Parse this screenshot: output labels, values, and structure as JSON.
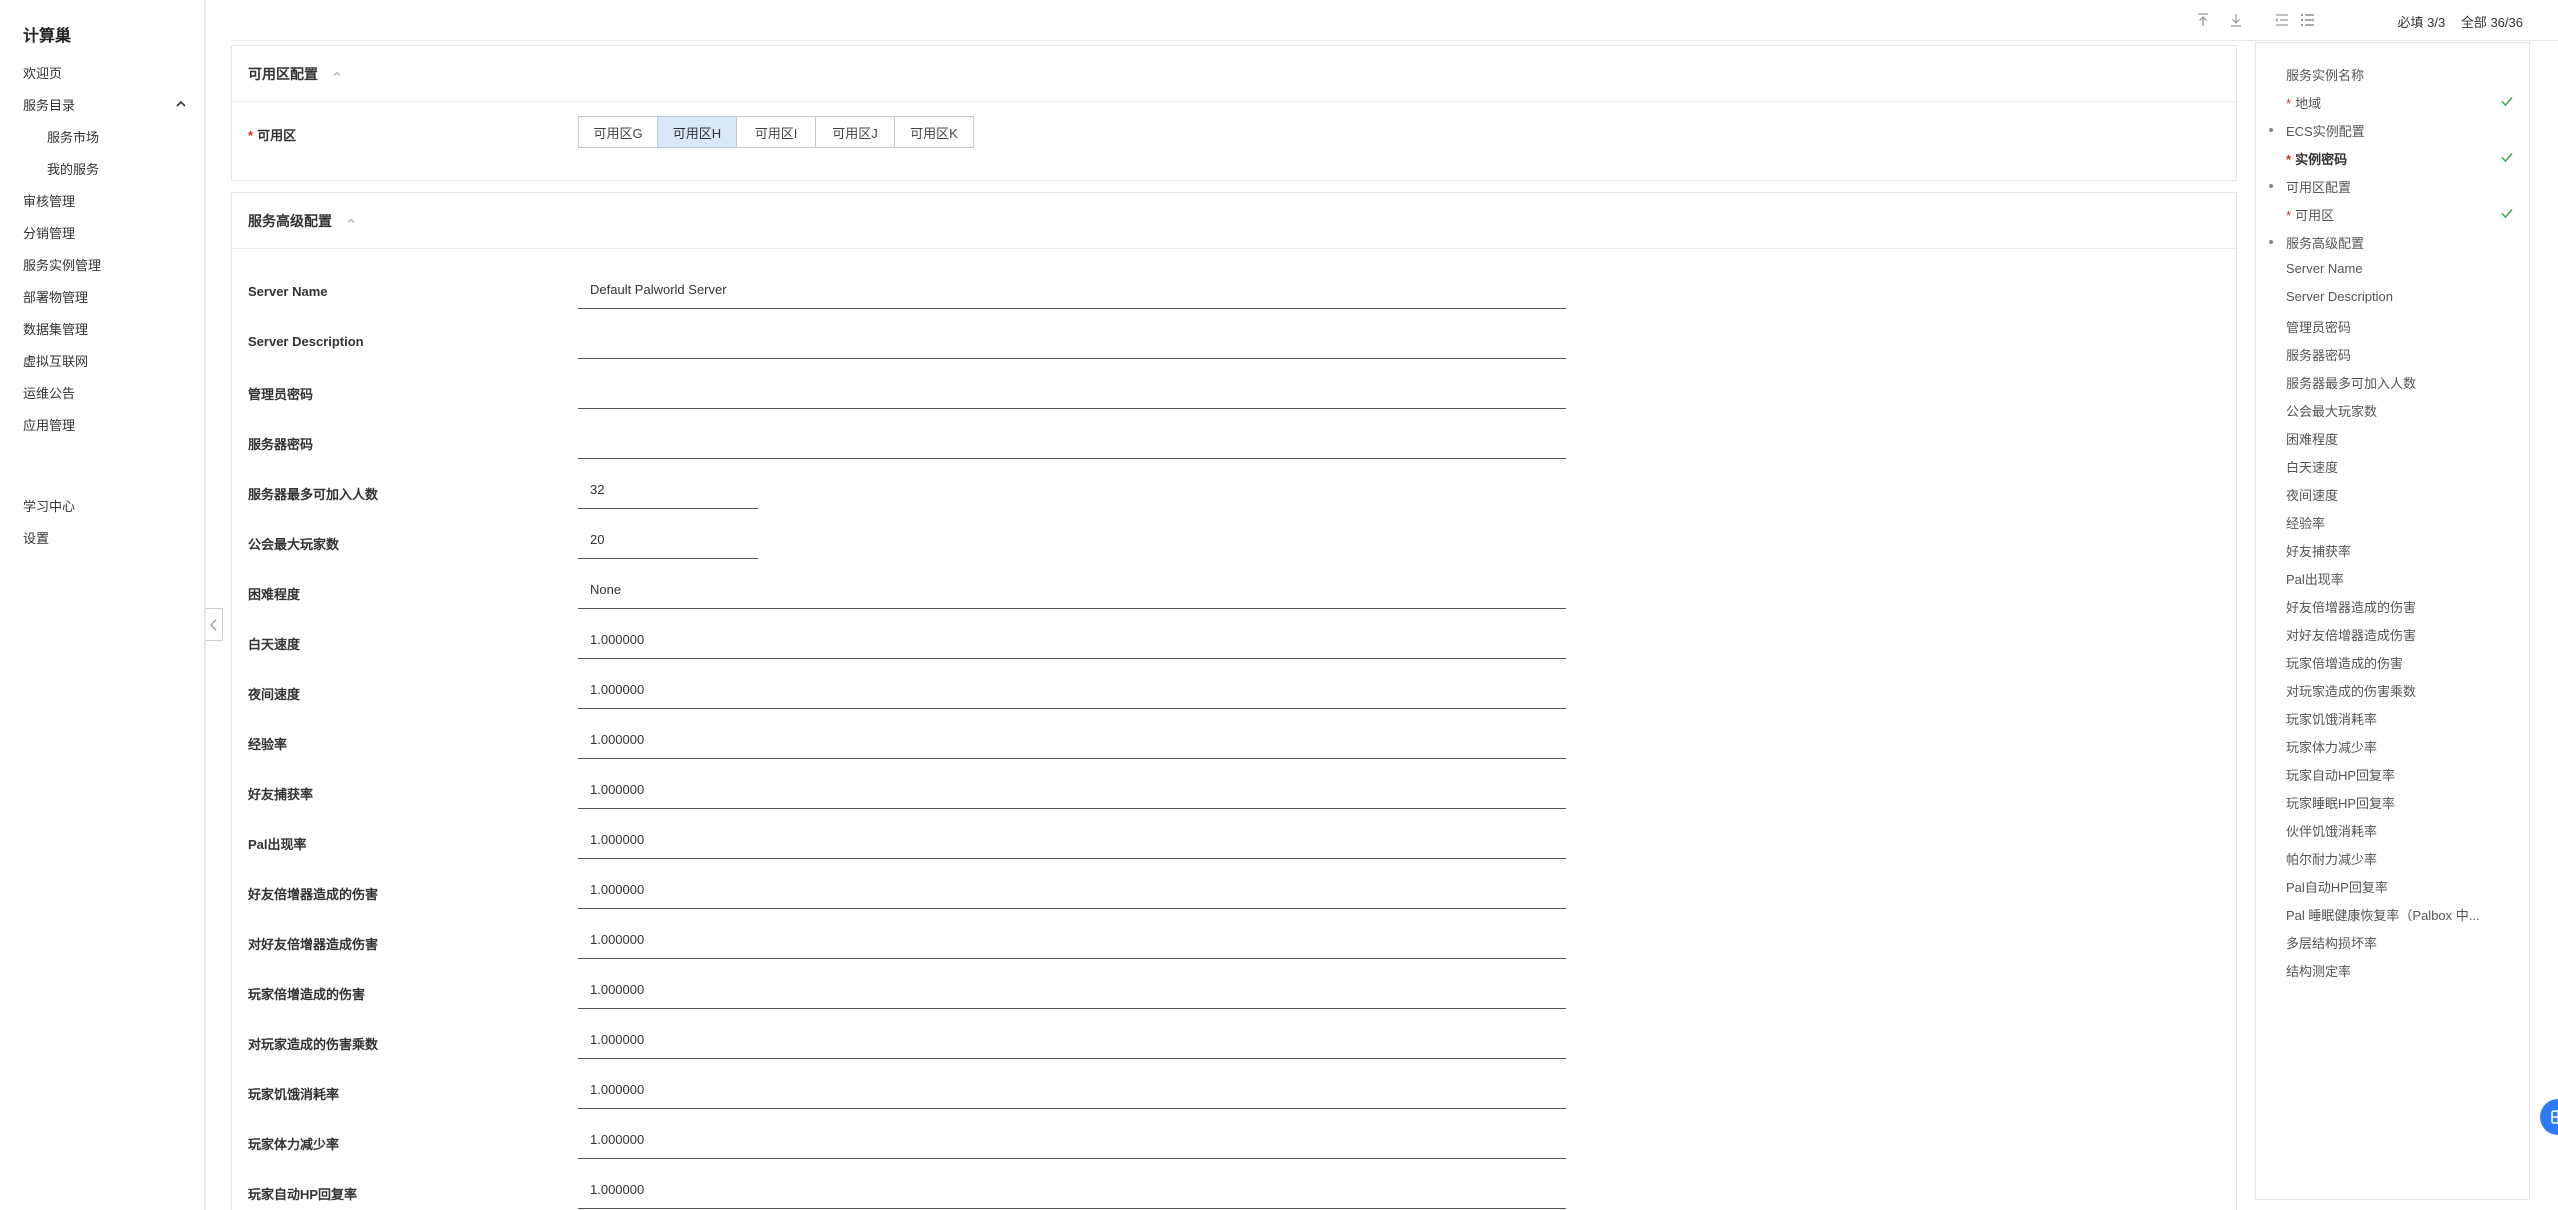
{
  "sidebar": {
    "brand": "计算巢",
    "items": [
      {
        "label": "欢迎页"
      },
      {
        "label": "服务目录",
        "expanded": true
      },
      {
        "label": "服务市场",
        "sub": true
      },
      {
        "label": "我的服务",
        "sub": true
      },
      {
        "label": "审核管理"
      },
      {
        "label": "分销管理"
      },
      {
        "label": "服务实例管理"
      },
      {
        "label": "部署物管理"
      },
      {
        "label": "数据集管理"
      },
      {
        "label": "虚拟互联网"
      },
      {
        "label": "运维公告"
      },
      {
        "label": "应用管理"
      }
    ],
    "bottom_items": [
      {
        "label": "学习中心"
      },
      {
        "label": "设置"
      }
    ]
  },
  "toolbar": {
    "icons": [
      "scroll-to-top-icon",
      "scroll-to-bottom-icon",
      "collapse-all-icon",
      "expand-all-icon"
    ],
    "required_stat": "必填 3/3",
    "total_stat": "全部 36/36"
  },
  "az_section": {
    "title": "可用区配置",
    "field_label": "可用区",
    "options": [
      "可用区G",
      "可用区H",
      "可用区I",
      "可用区J",
      "可用区K"
    ],
    "selected": "可用区H"
  },
  "advanced_section": {
    "title": "服务高级配置",
    "fields": [
      {
        "label": "Server Name",
        "value": "Default Palworld Server",
        "width": "wide"
      },
      {
        "label": "Server Description",
        "value": "",
        "width": "wide"
      },
      {
        "label": "管理员密码",
        "value": "",
        "width": "wide"
      },
      {
        "label": "服务器密码",
        "value": "",
        "width": "wide"
      },
      {
        "label": "服务器最多可加入人数",
        "value": "32",
        "width": "narrow"
      },
      {
        "label": "公会最大玩家数",
        "value": "20",
        "width": "narrow"
      },
      {
        "label": "困难程度",
        "value": "None",
        "width": "wide"
      },
      {
        "label": "白天速度",
        "value": "1.000000",
        "width": "wide"
      },
      {
        "label": "夜间速度",
        "value": "1.000000",
        "width": "wide"
      },
      {
        "label": "经验率",
        "value": "1.000000",
        "width": "wide"
      },
      {
        "label": "好友捕获率",
        "value": "1.000000",
        "width": "wide"
      },
      {
        "label": "Pal出现率",
        "value": "1.000000",
        "width": "wide"
      },
      {
        "label": "好友倍增器造成的伤害",
        "value": "1.000000",
        "width": "wide"
      },
      {
        "label": "对好友倍增器造成伤害",
        "value": "1.000000",
        "width": "wide"
      },
      {
        "label": "玩家倍增造成的伤害",
        "value": "1.000000",
        "width": "wide"
      },
      {
        "label": "对玩家造成的伤害乘数",
        "value": "1.000000",
        "width": "wide"
      },
      {
        "label": "玩家饥饿消耗率",
        "value": "1.000000",
        "width": "wide"
      },
      {
        "label": "玩家体力减少率",
        "value": "1.000000",
        "width": "wide"
      },
      {
        "label": "玩家自动HP回复率",
        "value": "1.000000",
        "width": "wide"
      }
    ]
  },
  "outline": {
    "items": [
      {
        "label": "服务实例名称",
        "level": 1
      },
      {
        "label": "地域",
        "level": 2,
        "required": true,
        "checked": true
      },
      {
        "label": "ECS实例配置",
        "level": 1,
        "dot": true
      },
      {
        "label": "实例密码",
        "level": 2,
        "required": true,
        "checked": true,
        "bold": true
      },
      {
        "label": "可用区配置",
        "level": 1,
        "dot": true
      },
      {
        "label": "可用区",
        "level": 2,
        "required": true,
        "checked": true
      },
      {
        "label": "服务高级配置",
        "level": 1,
        "dot": true
      },
      {
        "label": "Server Name",
        "level": 1
      },
      {
        "label": "Server Description",
        "level": 1
      },
      {
        "label": "管理员密码",
        "level": 1
      },
      {
        "label": "服务器密码",
        "level": 1
      },
      {
        "label": "服务器最多可加入人数",
        "level": 1
      },
      {
        "label": "公会最大玩家数",
        "level": 1
      },
      {
        "label": "困难程度",
        "level": 1
      },
      {
        "label": "白天速度",
        "level": 1
      },
      {
        "label": "夜间速度",
        "level": 1
      },
      {
        "label": "经验率",
        "level": 1
      },
      {
        "label": "好友捕获率",
        "level": 1
      },
      {
        "label": "Pal出现率",
        "level": 1
      },
      {
        "label": "好友倍增器造成的伤害",
        "level": 1
      },
      {
        "label": "对好友倍增器造成伤害",
        "level": 1
      },
      {
        "label": "玩家倍增造成的伤害",
        "level": 1
      },
      {
        "label": "对玩家造成的伤害乘数",
        "level": 1
      },
      {
        "label": "玩家饥饿消耗率",
        "level": 1
      },
      {
        "label": "玩家体力减少率",
        "level": 1
      },
      {
        "label": "玩家自动HP回复率",
        "level": 1
      },
      {
        "label": "玩家睡眠HP回复率",
        "level": 1
      },
      {
        "label": "伙伴饥饿消耗率",
        "level": 1
      },
      {
        "label": "帕尔耐力减少率",
        "level": 1
      },
      {
        "label": "Pal自动HP回复率",
        "level": 1
      },
      {
        "label": "Pal 睡眠健康恢复率（Palbox 中...",
        "level": 1
      },
      {
        "label": "多层结构损坏率",
        "level": 1
      },
      {
        "label": "结构测定率",
        "level": 1
      }
    ]
  },
  "colors": {
    "accent": "#2d7bf7",
    "selected_bg": "#d9e7fa",
    "required": "#e0281e",
    "check": "#3aa55a"
  },
  "fab_icon": "help-chat-icon"
}
